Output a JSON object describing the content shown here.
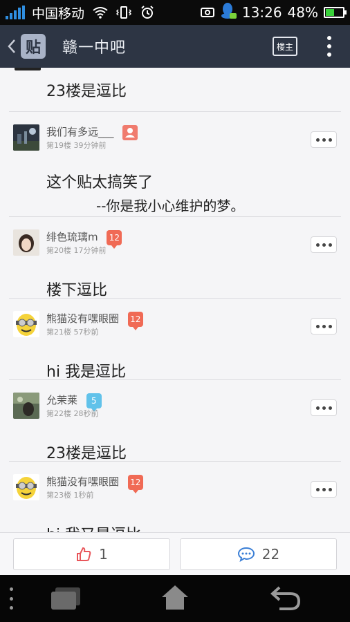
{
  "status_bar": {
    "carrier": "中国移动",
    "time": "13:26",
    "battery": "48%",
    "battery_level": 0.48,
    "icons": [
      "signal-icon",
      "wifi-icon",
      "vibrate-icon",
      "alarm-icon",
      "screenshot-icon",
      "qq-icon",
      "battery-icon"
    ]
  },
  "header": {
    "logo_text": "贴",
    "title": "赣一中吧",
    "op_button": "楼主"
  },
  "partial_post": {
    "text": "23楼是逗比"
  },
  "posts": [
    {
      "username": "我们有多远___",
      "meta": "第19楼  39分钟前",
      "badge": "",
      "badge_type": "user",
      "body": "这个贴太搞笑了",
      "signature": "--你是我小心维护的梦。"
    },
    {
      "username": "绯色琉璃m",
      "meta": "第20楼  17分钟前",
      "badge": "12",
      "badge_type": "red",
      "body": "楼下逗比",
      "signature": ""
    },
    {
      "username": "熊猫没有嘿眼圈",
      "meta": "第21楼  57秒前",
      "badge": "12",
      "badge_type": "red",
      "body": "hi 我是逗比",
      "signature": ""
    },
    {
      "username": "允茉莱",
      "meta": "第22楼  28秒前",
      "badge": "5",
      "badge_type": "blue",
      "body": "23楼是逗比",
      "signature": ""
    },
    {
      "username": "熊猫没有嘿眼圈",
      "meta": "第23楼  1秒前",
      "badge": "12",
      "badge_type": "red",
      "body": "hi 我又是逗比",
      "signature": ""
    }
  ],
  "action_bar": {
    "like_count": "1",
    "comment_count": "22"
  }
}
